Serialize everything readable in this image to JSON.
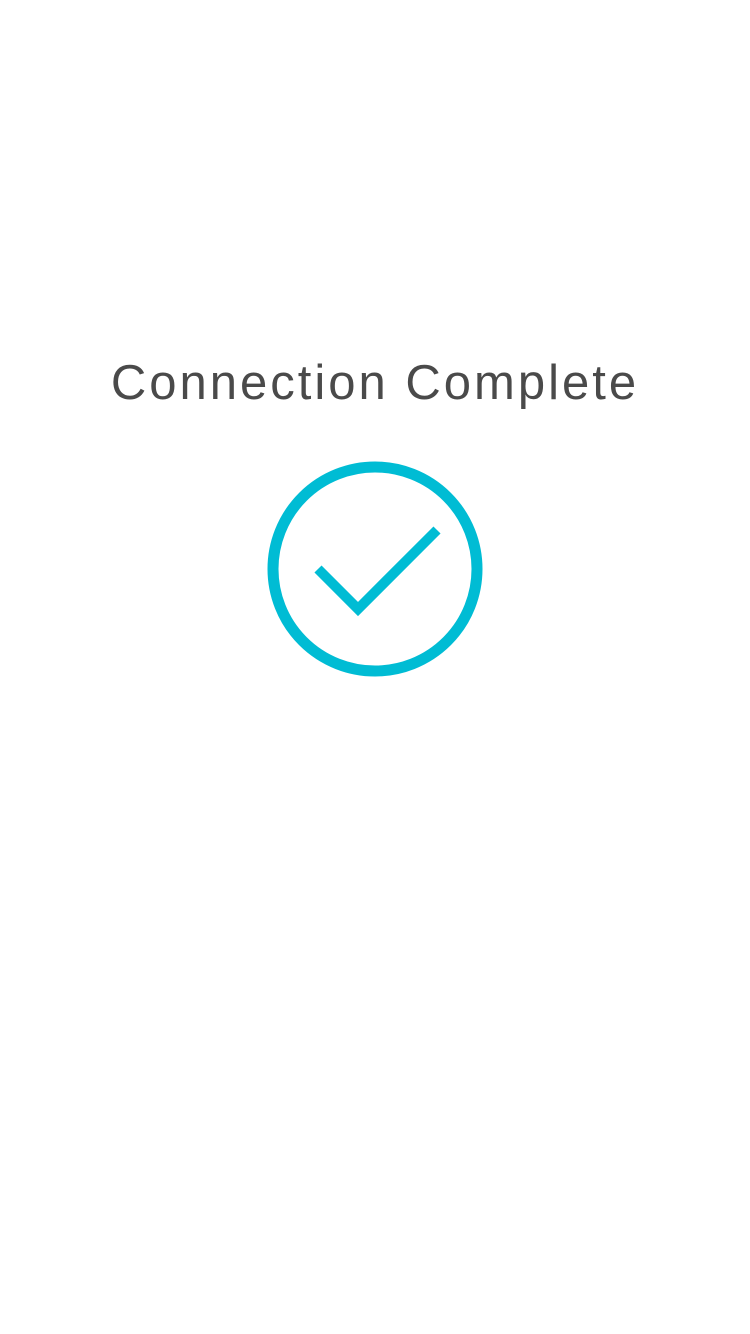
{
  "screen": {
    "title": "Connection Complete",
    "status_icon": "check-circle-icon"
  },
  "colors": {
    "background": "#ffffff",
    "title_text": "#4a4a4a",
    "accent": "#00bcd4"
  }
}
